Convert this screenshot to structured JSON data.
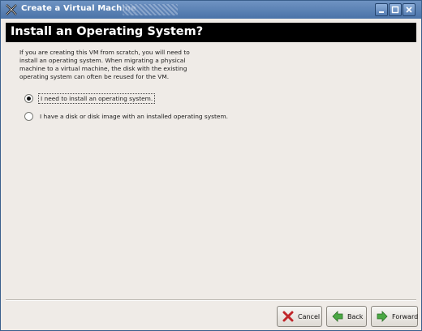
{
  "window": {
    "title": "Create a Virtual Machine"
  },
  "header": {
    "title": "Install an Operating System?"
  },
  "description": {
    "lines": [
      "If you are creating this VM from scratch, you will need to",
      "install an operating system.  When migrating a physical",
      "machine to a virtual machine, the disk with the existing",
      "operating system can often be reused for the VM."
    ]
  },
  "options": [
    {
      "label": "I need to install an operating system.",
      "selected": true
    },
    {
      "label": "I have a disk or disk image with an installed operating system.",
      "selected": false
    }
  ],
  "buttons": {
    "cancel": "Cancel",
    "back": "Back",
    "forward": "Forward"
  },
  "colors": {
    "titlebar": "#4a73a8",
    "banner": "#000000",
    "cancel_icon": "#c0262a",
    "nav_icon": "#3e9a3a"
  }
}
